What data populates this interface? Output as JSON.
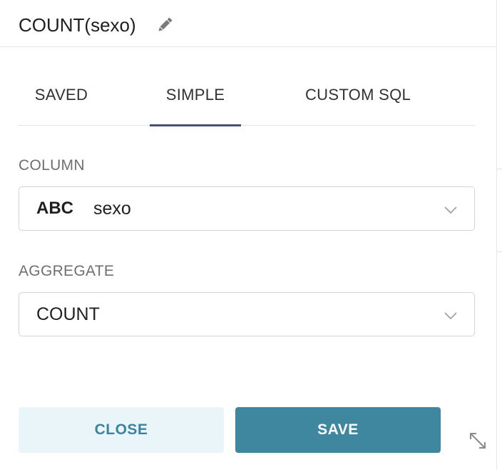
{
  "header": {
    "title": "COUNT(sexo)",
    "edit_icon": "pencil-icon"
  },
  "tabs": [
    {
      "label": "SAVED",
      "active": false
    },
    {
      "label": "SIMPLE",
      "active": true
    },
    {
      "label": "CUSTOM SQL",
      "active": false
    }
  ],
  "column": {
    "label": "COLUMN",
    "type_badge": "ABC",
    "value": "sexo"
  },
  "aggregate": {
    "label": "AGGREGATE",
    "value": "COUNT"
  },
  "footer": {
    "close_label": "CLOSE",
    "save_label": "SAVE",
    "resize_icon": "resize-icon"
  },
  "colors": {
    "accent": "#3f869f",
    "close_bg": "#e9f5f8",
    "tab_indicator": "#484f78"
  }
}
